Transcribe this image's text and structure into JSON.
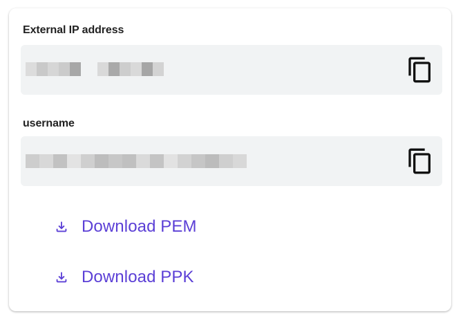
{
  "external_ip": {
    "label": "External IP address",
    "value_obscured": true
  },
  "username": {
    "label": "username",
    "value_obscured": true
  },
  "downloads": {
    "pem_label": "Download PEM",
    "ppk_label": "Download PPK"
  },
  "colors": {
    "link": "#5b3fd6",
    "field_background": "#f1f3f4",
    "label_text": "#222222",
    "icon": "#111111"
  },
  "icons": {
    "copy": "copy-icon",
    "download": "download-icon"
  }
}
